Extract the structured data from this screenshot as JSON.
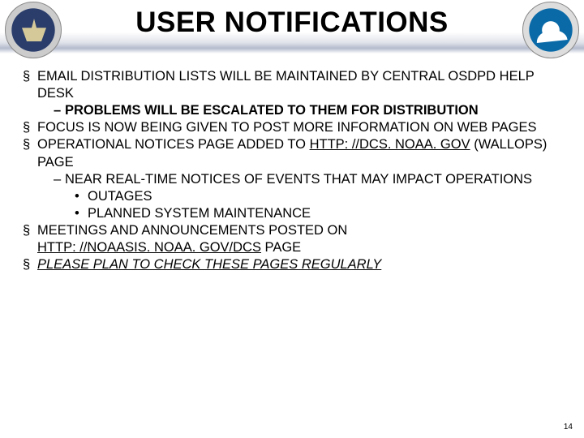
{
  "title": "USER NOTIFICATIONS",
  "sections": [
    {
      "text": " EMAIL DISTRIBUTION LISTS WILL BE MAINTAINED BY CENTRAL OSDPD HELP DESK",
      "sub": "PROBLEMS WILL BE ESCALATED TO THEM FOR DISTRIBUTION"
    },
    {
      "text": "FOCUS IS NOW BEING GIVEN TO POST MORE INFORMATION ON WEB PAGES"
    },
    {
      "prefix": "OPERATIONAL NOTICES PAGE ADDED TO ",
      "link": "HTTP: //DCS. NOAA. GOV",
      "suffix": " (WALLOPS) PAGE",
      "sub2": "NEAR REAL-TIME NOTICES OF EVENTS THAT MAY IMPACT OPERATIONS",
      "bullets": [
        "OUTAGES",
        "PLANNED SYSTEM MAINTENANCE"
      ]
    },
    {
      "prefix": "MEETINGS AND ANNOUNCEMENTS POSTED ON ",
      "link": "HTTP: //NOAASIS. NOAA. GOV/DCS",
      "suffix": " PAGE"
    },
    {
      "emph": "PLEASE PLAN TO CHECK THESE PAGES REGULARLY"
    }
  ],
  "page_number": "14",
  "marks": {
    "section": "§",
    "dash": "–",
    "bullet": "•"
  }
}
